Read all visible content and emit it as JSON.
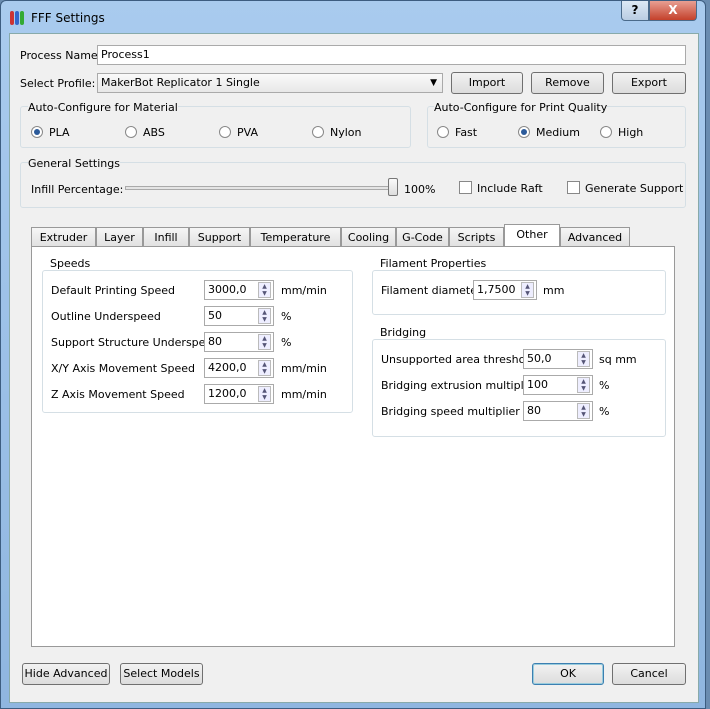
{
  "window": {
    "title": "FFF Settings",
    "help": "?",
    "close": "X"
  },
  "process_name": {
    "label": "Process Name:",
    "value": "Process1"
  },
  "profile": {
    "label": "Select Profile:",
    "value": "MakerBot Replicator 1 Single",
    "import": "Import",
    "remove": "Remove",
    "export": "Export"
  },
  "material": {
    "title": "Auto-Configure for Material",
    "options": [
      "PLA",
      "ABS",
      "PVA",
      "Nylon"
    ],
    "selected": "PLA"
  },
  "quality": {
    "title": "Auto-Configure for Print Quality",
    "options": [
      "Fast",
      "Medium",
      "High"
    ],
    "selected": "Medium"
  },
  "general": {
    "title": "General Settings",
    "infill_label": "Infill Percentage:",
    "infill_value": "100%",
    "infill_fraction": 1.0,
    "include_raft": "Include Raft",
    "generate_support": "Generate Support"
  },
  "tabs": [
    "Extruder",
    "Layer",
    "Infill",
    "Support",
    "Temperature",
    "Cooling",
    "G-Code",
    "Scripts",
    "Other",
    "Advanced"
  ],
  "active_tab": "Other",
  "speeds": {
    "title": "Speeds",
    "rows": [
      {
        "label": "Default Printing Speed",
        "value": "3000,0",
        "unit": "mm/min"
      },
      {
        "label": "Outline Underspeed",
        "value": "50",
        "unit": "%"
      },
      {
        "label": "Support Structure Underspeed",
        "value": "80",
        "unit": "%"
      },
      {
        "label": "X/Y Axis Movement Speed",
        "value": "4200,0",
        "unit": "mm/min"
      },
      {
        "label": "Z Axis Movement Speed",
        "value": "1200,0",
        "unit": "mm/min"
      }
    ]
  },
  "filament": {
    "title": "Filament Properties",
    "label": "Filament diameter",
    "value": "1,7500",
    "unit": "mm"
  },
  "bridging": {
    "title": "Bridging",
    "rows": [
      {
        "label": "Unsupported area threshold",
        "value": "50,0",
        "unit": "sq mm"
      },
      {
        "label": "Bridging extrusion multiplier",
        "value": "100",
        "unit": "%"
      },
      {
        "label": "Bridging speed multiplier",
        "value": "80",
        "unit": "%"
      }
    ]
  },
  "footer": {
    "hide_advanced": "Hide Advanced",
    "select_models": "Select Models",
    "ok": "OK",
    "cancel": "Cancel"
  }
}
